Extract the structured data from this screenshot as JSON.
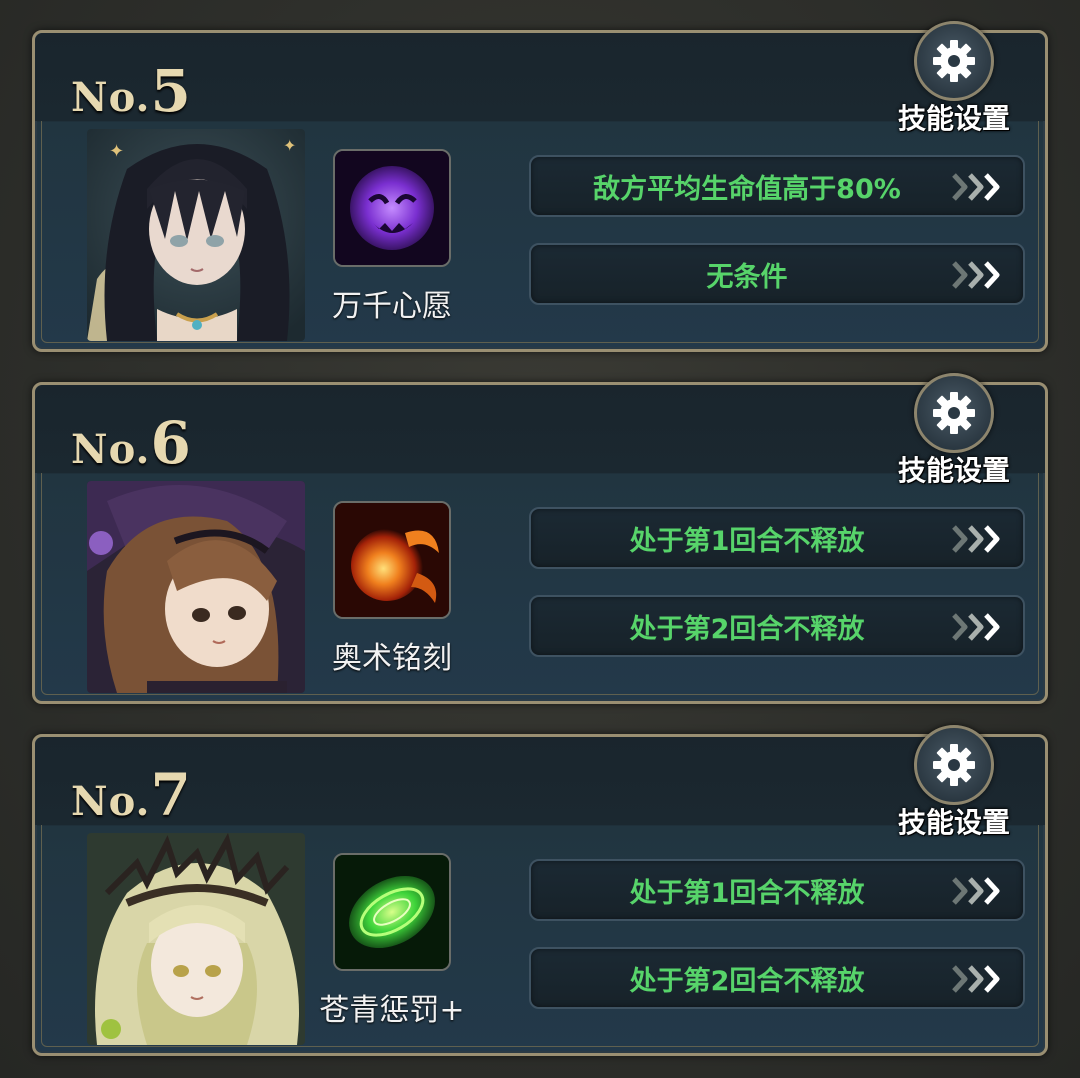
{
  "cards": [
    {
      "rank_prefix": "No.",
      "rank_number": "5",
      "settings_label": "技能设置",
      "skill_name": "万千心愿",
      "skill_color": "#8a3cd8",
      "conditions": [
        "敌方平均生命值高于80%",
        "无条件"
      ]
    },
    {
      "rank_prefix": "No.",
      "rank_number": "6",
      "settings_label": "技能设置",
      "skill_name": "奥术铭刻",
      "skill_color": "#e0621a",
      "conditions": [
        "处于第1回合不释放",
        "处于第2回合不释放"
      ]
    },
    {
      "rank_prefix": "No.",
      "rank_number": "7",
      "settings_label": "技能设置",
      "skill_name": "苍青惩罚+",
      "skill_color": "#3ed43a",
      "conditions": [
        "处于第1回合不释放",
        "处于第2回合不释放"
      ]
    }
  ],
  "colors": {
    "condition_text": "#57d46a",
    "frame_gold": "#9a8f72",
    "rank_text": "#e6d8b0"
  },
  "icons": {
    "settings": "gear-icon",
    "condition_arrow": "triple-chevron-right-icon"
  }
}
